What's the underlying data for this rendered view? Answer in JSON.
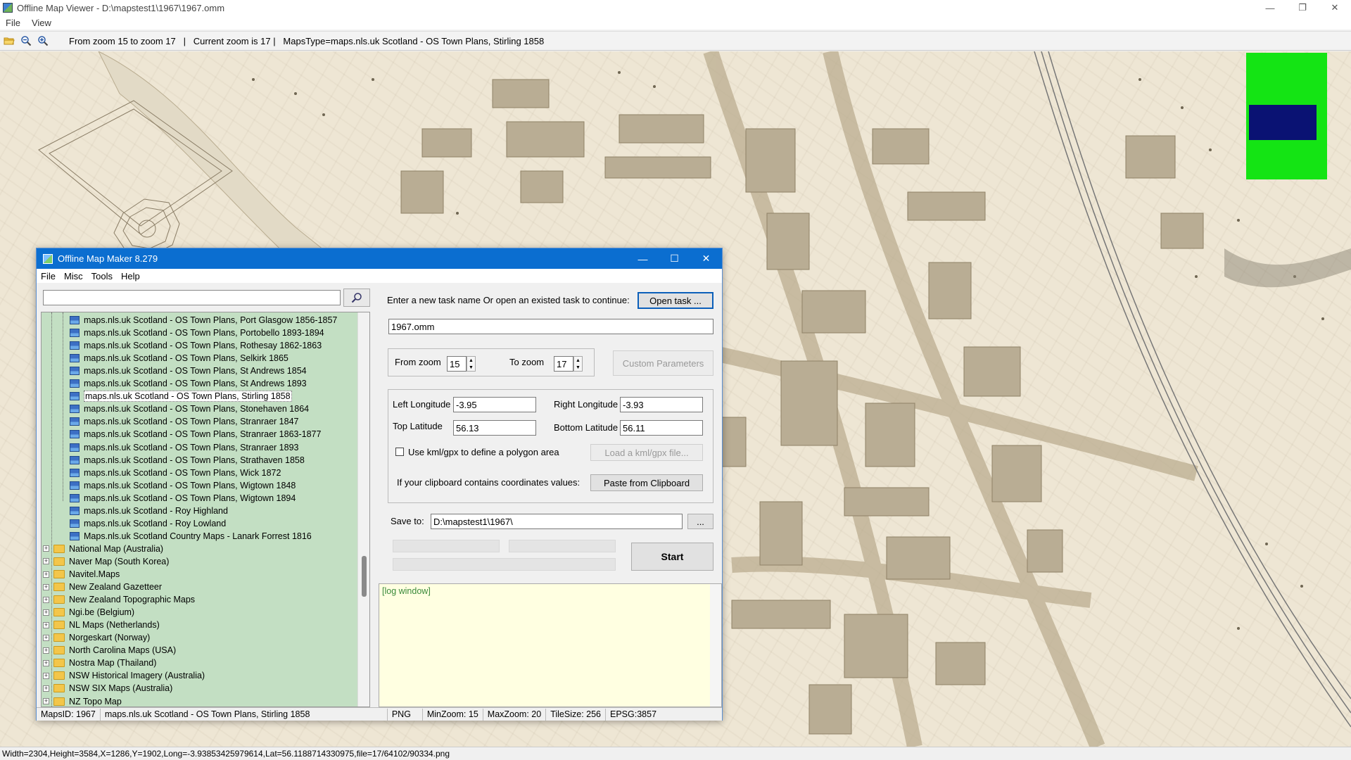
{
  "window": {
    "title": "Offline Map Viewer - D:\\mapstest1\\1967\\1967.omm",
    "controls": [
      "—",
      "❐",
      "✕"
    ]
  },
  "menu": [
    "File",
    "View"
  ],
  "toolbar": {
    "info": "From zoom 15 to zoom 17   |   Current zoom is 17 |   MapsType=maps.nls.uk Scotland - OS Town Plans, Stirling 1858",
    "icons": [
      "open-folder-icon",
      "zoom-out-icon",
      "zoom-in-icon"
    ]
  },
  "statusbar": "Width=2304,Height=3584,X=1286,Y=1902,Long=-3.93853425979614,Lat=56.1188714330975,file=17/64102/90334.png",
  "colors": {
    "minimap_bg": "#14e414",
    "minimap_view": "#0a1273",
    "dialog_title": "#0b6ed0",
    "tree_bg": "#c3dfc3",
    "log_bg": "#ffffe1"
  },
  "dialog": {
    "title": "Offline Map Maker 8.279",
    "menu": [
      "File",
      "Misc",
      "Tools",
      "Help"
    ],
    "search": {
      "value": "",
      "placeholder": ""
    },
    "tree": {
      "map_items": [
        "maps.nls.uk Scotland - OS Town Plans, Port Glasgow 1856-1857",
        "maps.nls.uk Scotland - OS Town Plans, Portobello 1893-1894",
        "maps.nls.uk Scotland - OS Town Plans, Rothesay 1862-1863",
        "maps.nls.uk Scotland - OS Town Plans, Selkirk 1865",
        "maps.nls.uk Scotland - OS Town Plans, St Andrews 1854",
        "maps.nls.uk Scotland - OS Town Plans, St Andrews 1893",
        "maps.nls.uk Scotland - OS Town Plans, Stirling 1858",
        "maps.nls.uk Scotland - OS Town Plans, Stonehaven 1864",
        "maps.nls.uk Scotland - OS Town Plans, Stranraer 1847",
        "maps.nls.uk Scotland - OS Town Plans, Stranraer 1863-1877",
        "maps.nls.uk Scotland - OS Town Plans, Stranraer 1893",
        "maps.nls.uk Scotland - OS Town Plans, Strathaven 1858",
        "maps.nls.uk Scotland - OS Town Plans, Wick 1872",
        "maps.nls.uk Scotland - OS Town Plans, Wigtown 1848",
        "maps.nls.uk Scotland - OS Town Plans, Wigtown 1894",
        "maps.nls.uk Scotland - Roy Highland",
        "maps.nls.uk Scotland - Roy Lowland",
        "Maps.nls.uk Scotland Country Maps - Lanark Forrest 1816"
      ],
      "selected_index": 6,
      "folders": [
        "National Map (Australia)",
        "Naver Map (South Korea)",
        "Navitel.Maps",
        "New Zealand Gazetteer",
        "New Zealand Topographic Maps",
        "Ngi.be (Belgium)",
        "NL Maps (Netherlands)",
        "Norgeskart (Norway)",
        "North Carolina Maps (USA)",
        "Nostra Map (Thailand)",
        "NSW Historical Imagery (Australia)",
        "NSW SIX Maps (Australia)",
        "NZ Topo Map"
      ]
    },
    "task": {
      "prompt": "Enter a new task name Or open an existed task to continue:",
      "open_button": "Open task ...",
      "name": "1967.omm"
    },
    "zoom": {
      "from_label": "From zoom",
      "from_value": "15",
      "to_label": "To zoom",
      "to_value": "17",
      "custom_button": "Custom Parameters"
    },
    "coords": {
      "left_lon_label": "Left Longitude",
      "left_lon": "-3.95",
      "right_lon_label": "Right Longitude",
      "right_lon": "-3.93",
      "top_lat_label": "Top Latitude",
      "top_lat": "56.13",
      "bottom_lat_label": "Bottom Latitude",
      "bottom_lat": "56.11",
      "kml_label": "Use kml/gpx to define a polygon area",
      "kml_button": "Load a kml/gpx file...",
      "clipboard_label": "If your clipboard contains coordinates values:",
      "clipboard_button": "Paste from Clipboard"
    },
    "save": {
      "label": "Save to:",
      "path": "D:\\mapstest1\\1967\\",
      "browse": "...",
      "start": "Start"
    },
    "log": "[log window]",
    "status": {
      "mapsid": "MapsID: 1967",
      "name": "maps.nls.uk Scotland - OS Town Plans, Stirling 1858",
      "format": "PNG",
      "minzoom": "MinZoom: 15",
      "maxzoom": "MaxZoom: 20",
      "tilesize": "TileSize: 256",
      "epsg": "EPSG:3857"
    }
  }
}
